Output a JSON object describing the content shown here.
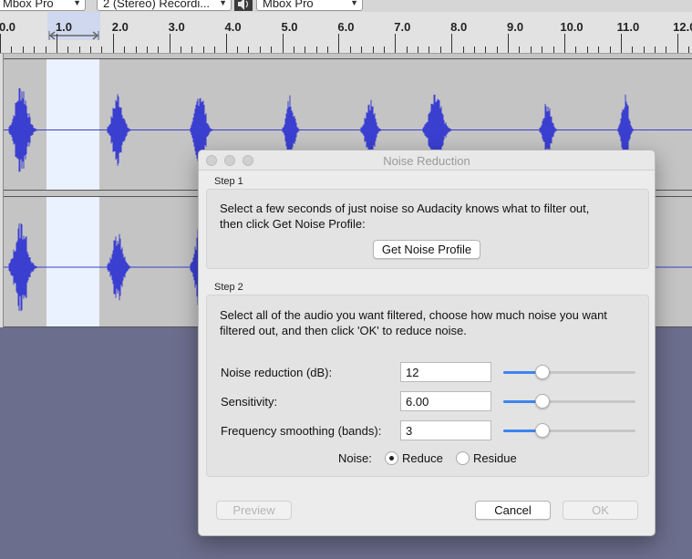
{
  "toolbar": {
    "playback_device": "Mbox Pro",
    "channels": "2 (Stereo) Recordi...",
    "recording_device": "Mbox Pro"
  },
  "ruler": {
    "ticks": [
      "0.0",
      "1.0",
      "2.0",
      "3.0",
      "4.0",
      "5.0",
      "6.0",
      "7.0",
      "8.0",
      "9.0",
      "10.0",
      "11.0",
      "12.0"
    ]
  },
  "colors": {
    "waveform": "#3b3fd0",
    "selection": "#eaf1ff",
    "accent": "#3d84ef"
  },
  "dialog": {
    "title": "Noise Reduction",
    "step1": {
      "label": "Step 1",
      "text_line1": "Select a few seconds of just noise so Audacity knows what to filter out,",
      "text_line2": "then click Get Noise Profile:",
      "button": "Get Noise Profile"
    },
    "step2": {
      "label": "Step 2",
      "text_line1": "Select all of the audio you want filtered, choose how much noise you want",
      "text_line2": "filtered out, and then click 'OK' to reduce noise.",
      "noise_reduction": {
        "label": "Noise reduction (dB):",
        "value": "12",
        "level": 0.27
      },
      "sensitivity": {
        "label": "Sensitivity:",
        "value": "6.00",
        "level": 0.27
      },
      "frequency_smoothing": {
        "label": "Frequency smoothing (bands):",
        "value": "3",
        "level": 0.27
      },
      "noise_label": "Noise:",
      "options": [
        "Reduce",
        "Residue"
      ],
      "selected_option": "Reduce"
    },
    "buttons": {
      "preview": "Preview",
      "cancel": "Cancel",
      "ok": "OK"
    }
  }
}
